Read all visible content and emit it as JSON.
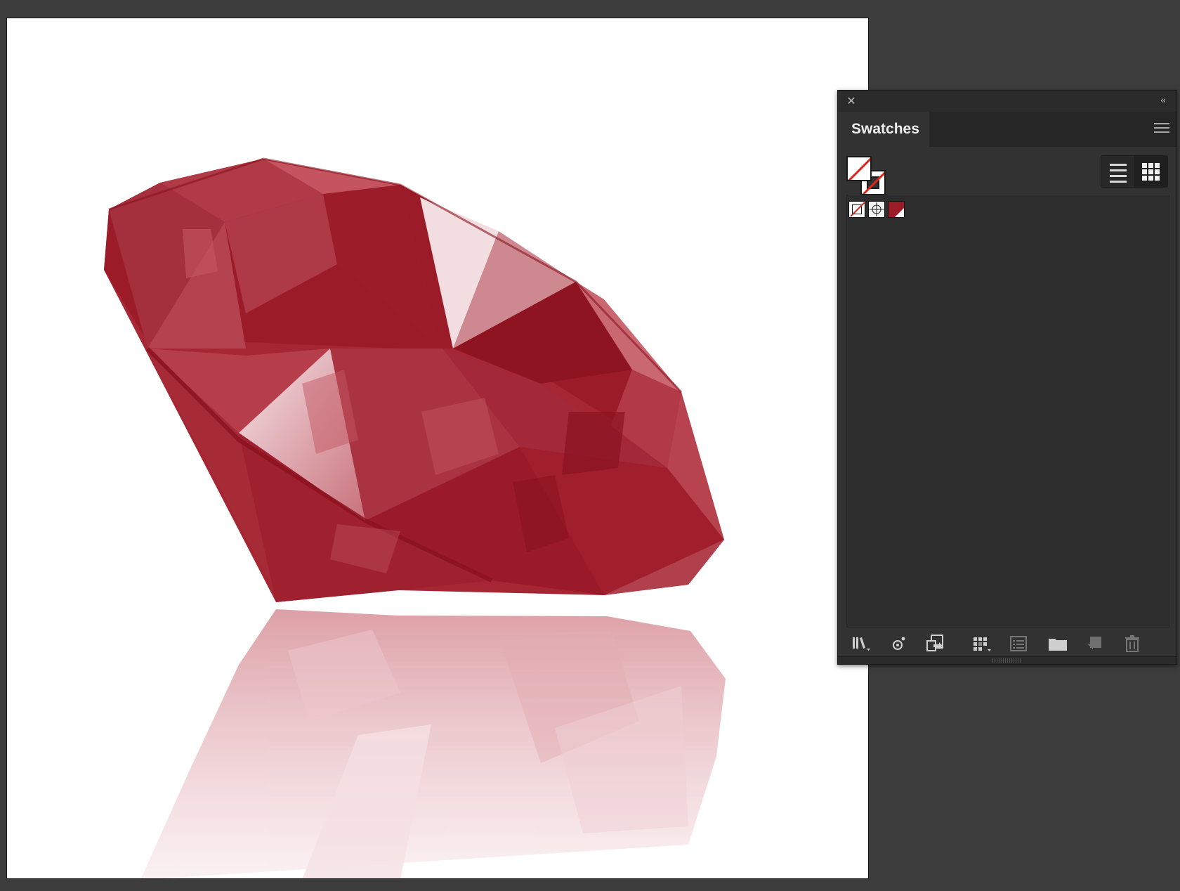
{
  "panel": {
    "tab_label": "Swatches",
    "close_icon": "close-icon",
    "collapse_label": "‹‹",
    "menu_icon": "menu-icon"
  },
  "swatches": [
    {
      "name": "none-swatch"
    },
    {
      "name": "registration-swatch"
    },
    {
      "name": "ruby-red-swatch",
      "color": "#9b1b28"
    }
  ],
  "colors": {
    "ruby": "#9b1b28",
    "ruby_dark": "#8a121f",
    "ruby_light": "#c4545f",
    "highlight": "#f2dde1"
  },
  "bottom_tools": [
    "swatch-libraries-menu-icon",
    "add-used-colors-icon",
    "show-swatch-kinds-menu-icon",
    "swatch-options-icon",
    "new-color-group-icon",
    "new-swatch-icon",
    "delete-swatch-icon"
  ]
}
